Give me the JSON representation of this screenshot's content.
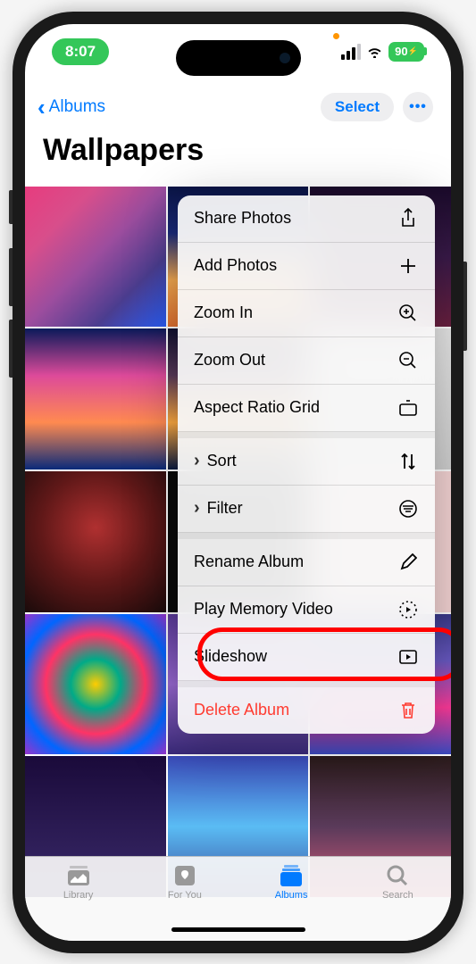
{
  "status": {
    "time": "8:07",
    "battery": "90"
  },
  "nav": {
    "back_label": "Albums",
    "select_label": "Select"
  },
  "album": {
    "title": "Wallpapers"
  },
  "menu": {
    "share": "Share Photos",
    "add": "Add Photos",
    "zoom_in": "Zoom In",
    "zoom_out": "Zoom Out",
    "aspect_ratio": "Aspect Ratio Grid",
    "sort": "Sort",
    "filter": "Filter",
    "rename": "Rename Album",
    "play_memory": "Play Memory Video",
    "slideshow": "Slideshow",
    "delete": "Delete Album"
  },
  "tabs": {
    "library": "Library",
    "for_you": "For You",
    "albums": "Albums",
    "search": "Search"
  }
}
